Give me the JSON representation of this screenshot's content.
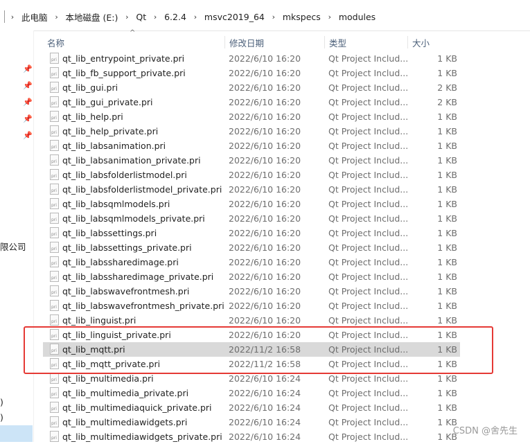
{
  "breadcrumb": [
    "此电脑",
    "本地磁盘 (E:)",
    "Qt",
    "6.2.4",
    "msvc2019_64",
    "mkspecs",
    "modules"
  ],
  "nav": {
    "company_label": "限公司",
    "truncated_items": [
      ")",
      ")"
    ]
  },
  "columns": {
    "name": "名称",
    "modified": "修改日期",
    "type": "类型",
    "size": "大小"
  },
  "files": [
    {
      "name": "qt_lib_entrypoint_private.pri",
      "modified": "2022/6/10 16:20",
      "type": "Qt Project Includ...",
      "size": "1 KB"
    },
    {
      "name": "qt_lib_fb_support_private.pri",
      "modified": "2022/6/10 16:20",
      "type": "Qt Project Includ...",
      "size": "1 KB"
    },
    {
      "name": "qt_lib_gui.pri",
      "modified": "2022/6/10 16:20",
      "type": "Qt Project Includ...",
      "size": "2 KB"
    },
    {
      "name": "qt_lib_gui_private.pri",
      "modified": "2022/6/10 16:20",
      "type": "Qt Project Includ...",
      "size": "2 KB"
    },
    {
      "name": "qt_lib_help.pri",
      "modified": "2022/6/10 16:20",
      "type": "Qt Project Includ...",
      "size": "1 KB"
    },
    {
      "name": "qt_lib_help_private.pri",
      "modified": "2022/6/10 16:20",
      "type": "Qt Project Includ...",
      "size": "1 KB"
    },
    {
      "name": "qt_lib_labsanimation.pri",
      "modified": "2022/6/10 16:20",
      "type": "Qt Project Includ...",
      "size": "1 KB"
    },
    {
      "name": "qt_lib_labsanimation_private.pri",
      "modified": "2022/6/10 16:20",
      "type": "Qt Project Includ...",
      "size": "1 KB"
    },
    {
      "name": "qt_lib_labsfolderlistmodel.pri",
      "modified": "2022/6/10 16:20",
      "type": "Qt Project Includ...",
      "size": "1 KB"
    },
    {
      "name": "qt_lib_labsfolderlistmodel_private.pri",
      "modified": "2022/6/10 16:20",
      "type": "Qt Project Includ...",
      "size": "1 KB"
    },
    {
      "name": "qt_lib_labsqmlmodels.pri",
      "modified": "2022/6/10 16:20",
      "type": "Qt Project Includ...",
      "size": "1 KB"
    },
    {
      "name": "qt_lib_labsqmlmodels_private.pri",
      "modified": "2022/6/10 16:20",
      "type": "Qt Project Includ...",
      "size": "1 KB"
    },
    {
      "name": "qt_lib_labssettings.pri",
      "modified": "2022/6/10 16:20",
      "type": "Qt Project Includ...",
      "size": "1 KB"
    },
    {
      "name": "qt_lib_labssettings_private.pri",
      "modified": "2022/6/10 16:20",
      "type": "Qt Project Includ...",
      "size": "1 KB"
    },
    {
      "name": "qt_lib_labssharedimage.pri",
      "modified": "2022/6/10 16:20",
      "type": "Qt Project Includ...",
      "size": "1 KB"
    },
    {
      "name": "qt_lib_labssharedimage_private.pri",
      "modified": "2022/6/10 16:20",
      "type": "Qt Project Includ...",
      "size": "1 KB"
    },
    {
      "name": "qt_lib_labswavefrontmesh.pri",
      "modified": "2022/6/10 16:20",
      "type": "Qt Project Includ...",
      "size": "1 KB"
    },
    {
      "name": "qt_lib_labswavefrontmesh_private.pri",
      "modified": "2022/6/10 16:20",
      "type": "Qt Project Includ...",
      "size": "1 KB"
    },
    {
      "name": "qt_lib_linguist.pri",
      "modified": "2022/6/10 16:20",
      "type": "Qt Project Includ...",
      "size": "1 KB"
    },
    {
      "name": "qt_lib_linguist_private.pri",
      "modified": "2022/6/10 16:20",
      "type": "Qt Project Includ...",
      "size": "1 KB"
    },
    {
      "name": "qt_lib_mqtt.pri",
      "modified": "2022/11/2 16:58",
      "type": "Qt Project Includ...",
      "size": "1 KB",
      "selected": true
    },
    {
      "name": "qt_lib_mqtt_private.pri",
      "modified": "2022/11/2 16:58",
      "type": "Qt Project Includ...",
      "size": "1 KB"
    },
    {
      "name": "qt_lib_multimedia.pri",
      "modified": "2022/6/10 16:24",
      "type": "Qt Project Includ...",
      "size": "1 KB"
    },
    {
      "name": "qt_lib_multimedia_private.pri",
      "modified": "2022/6/10 16:24",
      "type": "Qt Project Includ...",
      "size": "1 KB"
    },
    {
      "name": "qt_lib_multimediaquick_private.pri",
      "modified": "2022/6/10 16:24",
      "type": "Qt Project Includ...",
      "size": "1 KB"
    },
    {
      "name": "qt_lib_multimediawidgets.pri",
      "modified": "2022/6/10 16:24",
      "type": "Qt Project Includ...",
      "size": "1 KB"
    },
    {
      "name": "qt_lib_multimediawidgets_private.pri",
      "modified": "2022/6/10 16:24",
      "type": "Qt Project Includ...",
      "size": "1 KB"
    }
  ],
  "watermark": "CSDN @舍先生",
  "colors": {
    "highlight_border": "#e53935",
    "selected_row": "#d9d9d9",
    "header_text": "#4c607a"
  }
}
